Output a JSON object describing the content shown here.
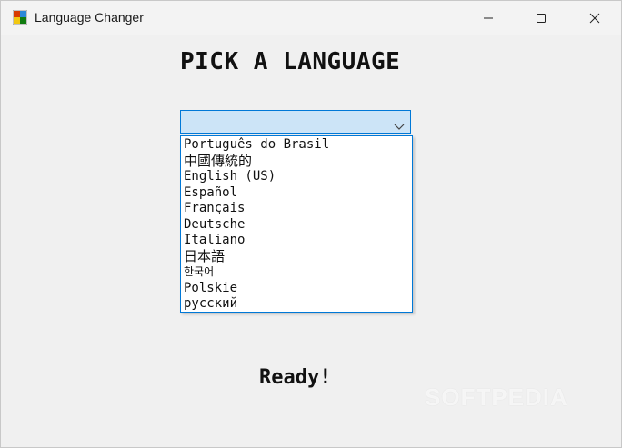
{
  "window": {
    "title": "Language Changer",
    "icon": "app-flag-icon",
    "controls": {
      "minimize_icon": "minimize-icon",
      "maximize_icon": "maximize-icon",
      "close_icon": "close-icon"
    }
  },
  "main": {
    "heading": "PICK A LANGUAGE",
    "language_select": {
      "selected_value": "",
      "options": [
        "Português do Brasil",
        "中國傳統的",
        "English (US)",
        "Español",
        "Français",
        "Deutsche",
        "Italiano",
        "日本語",
        "한국어",
        "Polskie",
        "русский"
      ]
    },
    "status": "Ready!"
  },
  "watermark": "SOFTPEDIA",
  "colors": {
    "background": "#f0f0f0",
    "combo_focus_bg": "#cce4f7",
    "accent_border": "#0078d7"
  }
}
